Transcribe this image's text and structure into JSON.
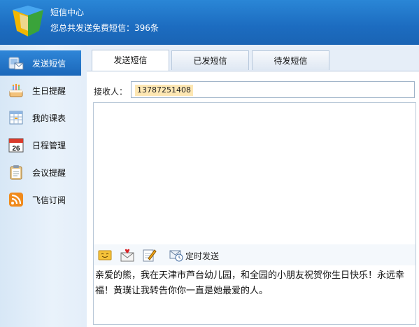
{
  "header": {
    "title": "短信中心",
    "subtitle": "您总共发送免费短信：396条"
  },
  "sidebar": {
    "items": [
      {
        "label": "发送短信",
        "icon": "sms-send-icon",
        "active": true
      },
      {
        "label": "生日提醒",
        "icon": "birthday-cake-icon"
      },
      {
        "label": "我的课表",
        "icon": "timetable-icon"
      },
      {
        "label": "日程管理",
        "icon": "calendar-icon",
        "icon_text": "26"
      },
      {
        "label": "会议提醒",
        "icon": "clipboard-icon"
      },
      {
        "label": "飞信订阅",
        "icon": "rss-icon"
      }
    ]
  },
  "tabs": [
    {
      "label": "发送短信",
      "active": true
    },
    {
      "label": "已发短信"
    },
    {
      "label": "待发短信"
    }
  ],
  "form": {
    "recipient_label": "接收人：",
    "recipient_value": "13787251408"
  },
  "toolbar": {
    "emoticon_icon": "emoticon-icon",
    "greeting_icon": "greeting-envelope-icon",
    "signature_icon": "signature-pen-icon",
    "schedule_icon": "scheduled-mail-icon",
    "schedule_label": "定时发送"
  },
  "message": {
    "text": "亲爱的熊，我在天津市芦台幼儿园，和全园的小朋友祝贺你生日快乐！永远幸福！黄璞让我转告你你一直是她最爱的人。"
  },
  "colors": {
    "header_blue": "#1c6cc0",
    "accent_active": "#2f86d8",
    "recipient_highlight": "#fde7b3"
  }
}
